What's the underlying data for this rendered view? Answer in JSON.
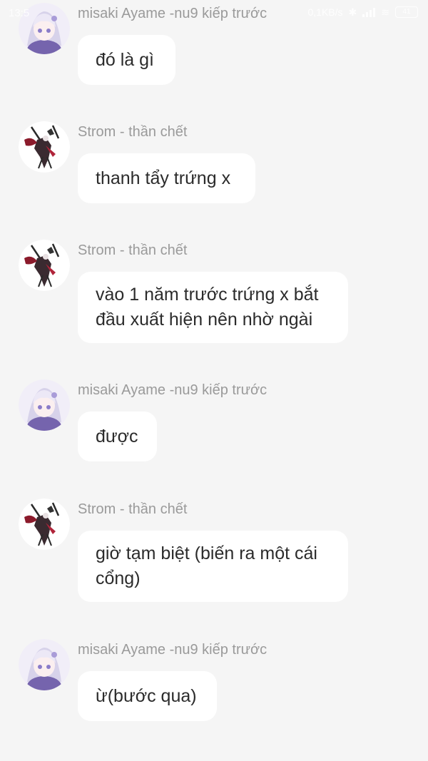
{
  "status_bar": {
    "time": "13:5",
    "network_speed": "0,1KB/s",
    "battery_level": "41",
    "icons": [
      "bluetooth-icon",
      "signal-icon",
      "wifi-icon",
      "battery-icon"
    ]
  },
  "messages": [
    {
      "sender": "misaki Ayame -nu9 kiếp trước",
      "avatar": "misaki-avatar",
      "text": "đó là gì"
    },
    {
      "sender": "Strom - thần chết",
      "avatar": "strom-avatar",
      "text": "thanh tẩy trứng x"
    },
    {
      "sender": "Strom - thần chết",
      "avatar": "strom-avatar",
      "text": "vào 1 năm trước trứng x bắt đầu xuất hiện nên nhờ ngài"
    },
    {
      "sender": "misaki Ayame -nu9 kiếp trước",
      "avatar": "misaki-avatar",
      "text": "được"
    },
    {
      "sender": "Strom - thần chết",
      "avatar": "strom-avatar",
      "text": "giờ tạm biệt (biến ra một cái cổng)"
    },
    {
      "sender": "misaki Ayame -nu9 kiếp trước",
      "avatar": "misaki-avatar",
      "text": "ừ(bước qua)"
    }
  ]
}
